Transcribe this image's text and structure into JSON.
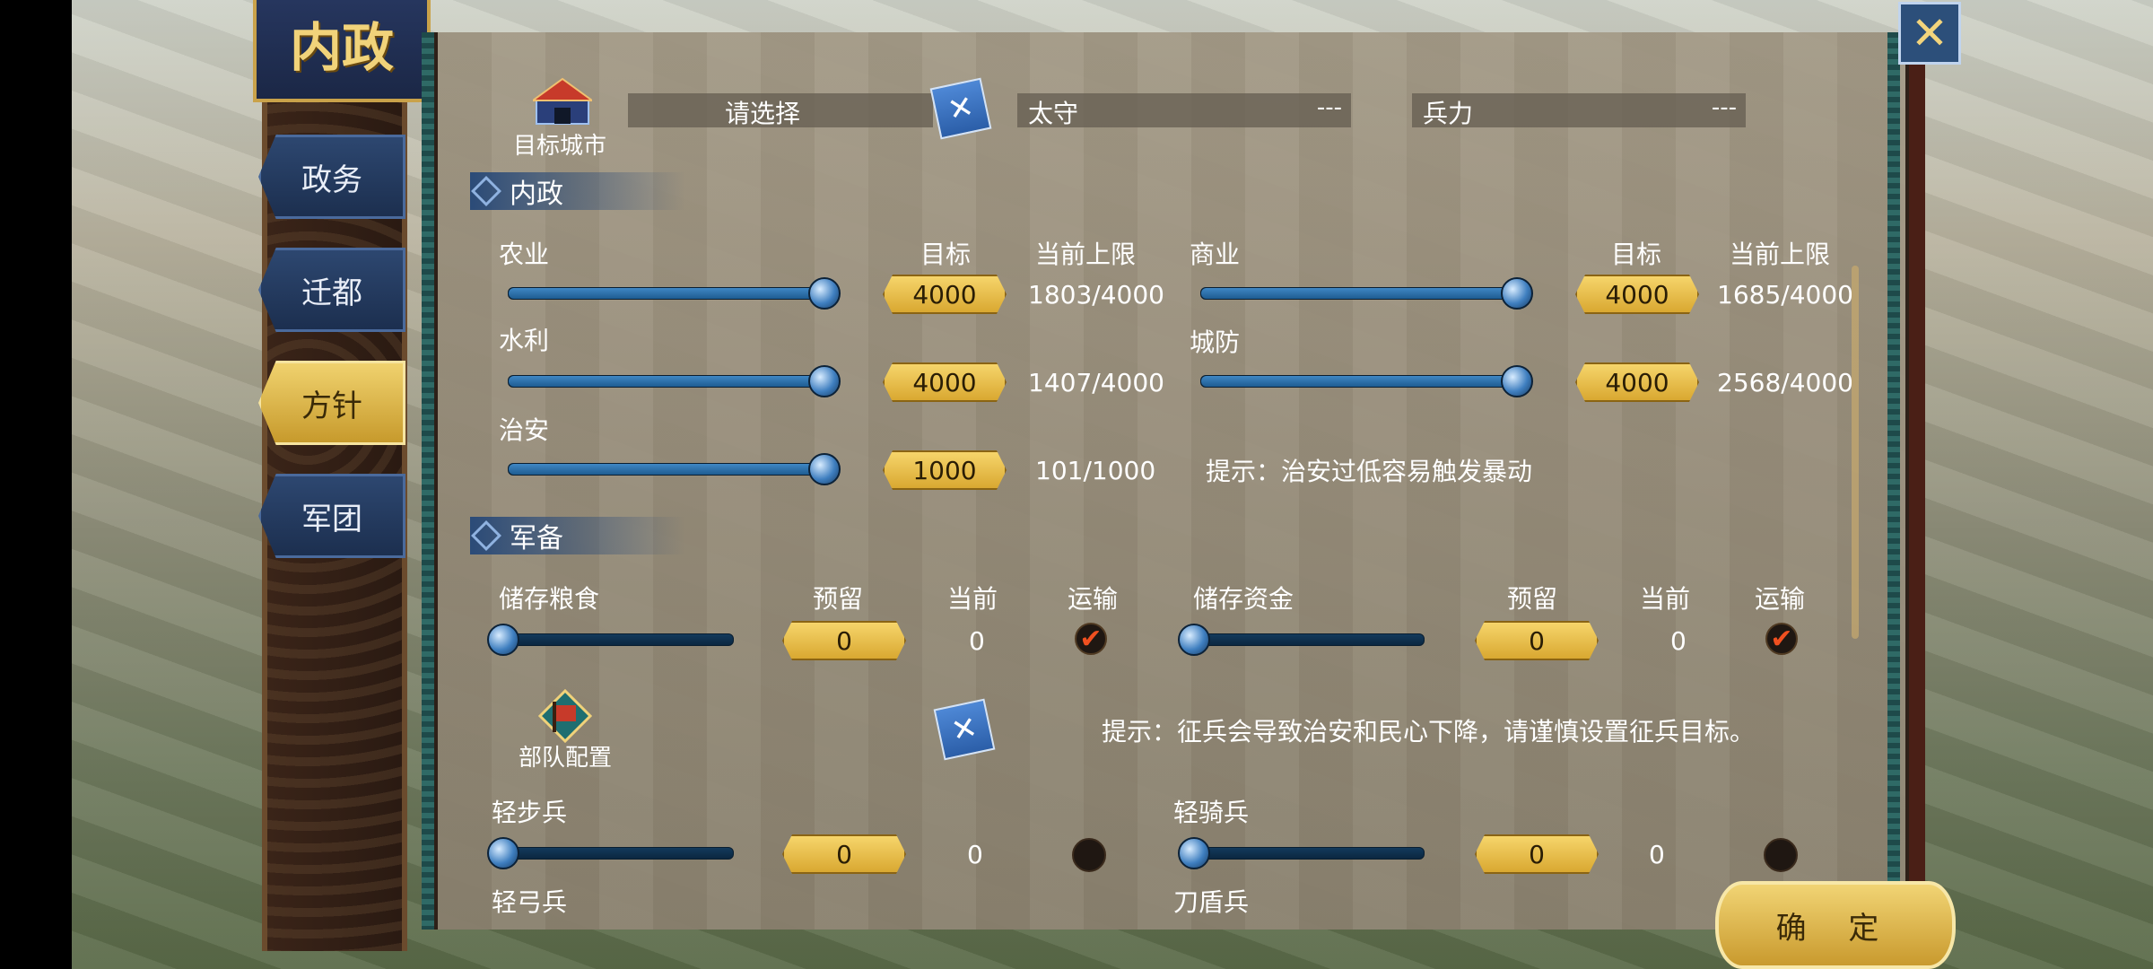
{
  "banner": {
    "title": "内政"
  },
  "tabs": [
    {
      "label": "政务",
      "active": false
    },
    {
      "label": "迁都",
      "active": false
    },
    {
      "label": "方针",
      "active": true
    },
    {
      "label": "军团",
      "active": false
    }
  ],
  "top": {
    "target_city_label": "目标城市",
    "select_label": "请选择",
    "governor": {
      "label": "太守",
      "value": "---"
    },
    "troops": {
      "label": "兵力",
      "value": "---"
    }
  },
  "internal": {
    "section_title": "内政",
    "target_header": "目标",
    "limit_header": "当前上限",
    "rows": [
      {
        "name": "农业",
        "target": "4000",
        "current": "1803/4000",
        "level": 1.0
      },
      {
        "name": "商业",
        "target": "4000",
        "current": "1685/4000",
        "level": 1.0
      },
      {
        "name": "水利",
        "target": "4000",
        "current": "1407/4000",
        "level": 1.0
      },
      {
        "name": "城防",
        "target": "4000",
        "current": "2568/4000",
        "level": 1.0
      },
      {
        "name": "治安",
        "target": "1000",
        "current": "101/1000",
        "level": 1.0
      }
    ],
    "hint": "提示：治安过低容易触发暴动"
  },
  "military": {
    "section_title": "军备",
    "reserve_header": "预留",
    "current_header": "当前",
    "transport_header": "运输",
    "rows": [
      {
        "name": "储存粮食",
        "reserve": "0",
        "current": "0",
        "transport": true,
        "level": 0
      },
      {
        "name": "储存资金",
        "reserve": "0",
        "current": "0",
        "transport": true,
        "level": 0
      }
    ]
  },
  "troops_config": {
    "label": "部队配置",
    "hint": "提示：征兵会导致治安和民心下降，请谨慎设置征兵目标。",
    "units": [
      {
        "name": "轻步兵",
        "reserve": "0",
        "current": "0",
        "level": 0
      },
      {
        "name": "轻骑兵",
        "reserve": "0",
        "current": "0",
        "level": 0
      },
      {
        "name": "轻弓兵"
      },
      {
        "name": "刀盾兵"
      }
    ]
  },
  "confirm_label": "确 定",
  "colors": {
    "accent_gold": "#d9a831",
    "tab_blue": "#2d4770",
    "check_red": "#f05020"
  }
}
